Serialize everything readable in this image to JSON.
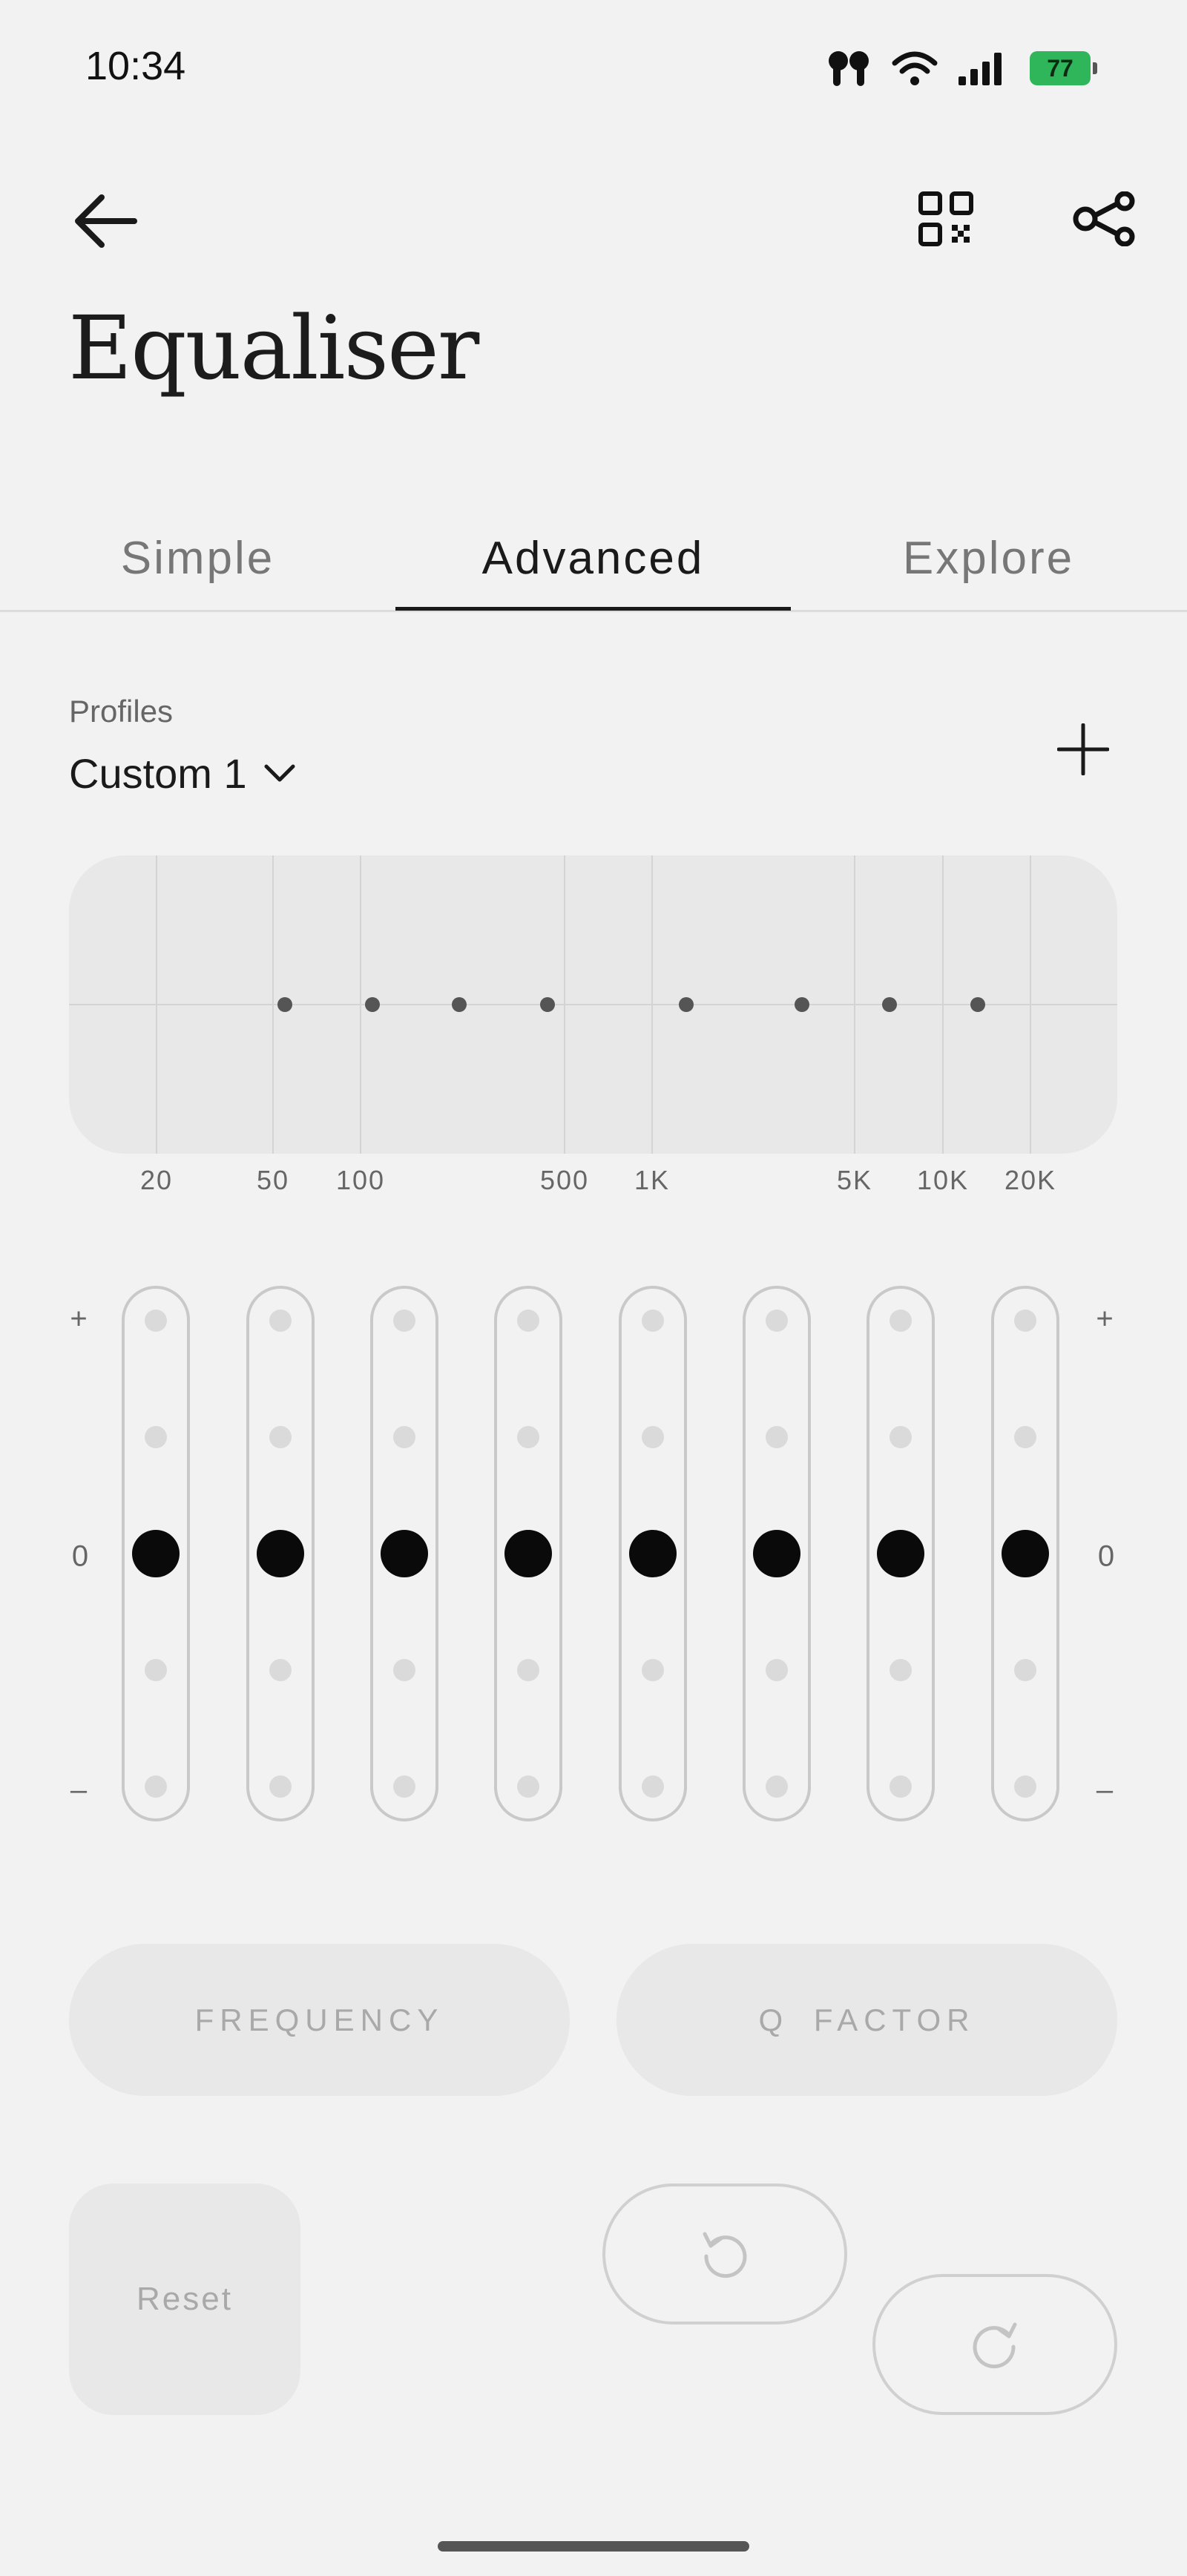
{
  "status_bar": {
    "time": "10:34",
    "battery": "77"
  },
  "header": {
    "title": "Equaliser"
  },
  "tabs": [
    {
      "label": "Simple"
    },
    {
      "label": "Advanced"
    },
    {
      "label": "Explore"
    }
  ],
  "profiles": {
    "label": "Profiles",
    "selected": "Custom 1"
  },
  "graph": {
    "x_ticks": [
      "20",
      "50",
      "100",
      "500",
      "1K",
      "5K",
      "10K",
      "20K"
    ],
    "band_levels_db": [
      0,
      0,
      0,
      0,
      0,
      0,
      0,
      0
    ]
  },
  "sliders": {
    "top_label": "+",
    "mid_label": "0",
    "bottom_label": "–",
    "values": [
      0,
      0,
      0,
      0,
      0,
      0,
      0,
      0
    ]
  },
  "controls": {
    "frequency_label": "FREQUENCY",
    "q_factor_label": "Q FACTOR",
    "reset_label": "Reset"
  },
  "icons": {
    "back": "arrow-left-icon",
    "qr": "qr-code-icon",
    "share": "share-icon",
    "add": "plus-icon",
    "dropdown": "chevron-down-icon",
    "undo": "undo-icon",
    "redo": "redo-icon"
  },
  "colors": {
    "battery": "#2fb55a",
    "knob": "#0a0a0a",
    "panel": "#e7e8e7"
  }
}
